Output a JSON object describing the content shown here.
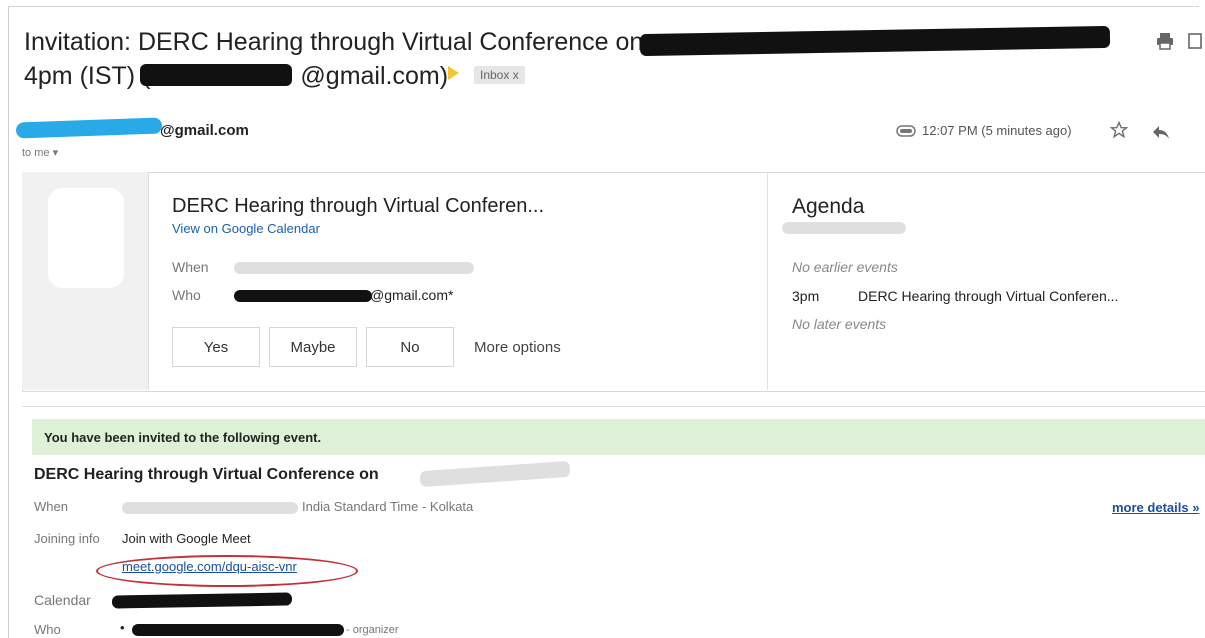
{
  "email": {
    "subject_line1": "Invitation: DERC Hearing through Virtual Conference on",
    "subject_line2_start": "4pm (IST) (",
    "subject_line2_end": "@gmail.com)",
    "inbox_badge": "Inbox x",
    "sender_suffix": "@gmail.com",
    "to_me": "to me ▾",
    "time": "12:07 PM (5 minutes ago)",
    "icons": [
      "printer-icon",
      "new-window-icon",
      "label-icon",
      "star-icon",
      "reply-icon"
    ]
  },
  "invite_card": {
    "title": "DERC Hearing through Virtual Conferen...",
    "view_link": "View on Google Calendar",
    "when_label": "When",
    "who_label": "Who",
    "who_value_suffix": "@gmail.com*",
    "rsvp": [
      "Yes",
      "Maybe",
      "No"
    ],
    "more_options": "More options"
  },
  "agenda": {
    "title": "Agenda",
    "no_earlier": "No earlier events",
    "event_time": "3pm",
    "event_title": "DERC Hearing through Virtual Conferen...",
    "no_later": "No later events"
  },
  "event_body": {
    "invited_text": "You have been invited to the following event.",
    "title": "DERC Hearing through Virtual Conference on",
    "when_label": "When",
    "when_value": "India Standard Time - Kolkata",
    "more_details": "more details »",
    "joining_label": "Joining info",
    "joining_value": "Join with Google Meet",
    "meet_link": "meet.google.com/dqu-aisc-vnr",
    "calendar_label": "Calendar",
    "who_label": "Who",
    "organizer": "- organizer"
  },
  "colors": {
    "green_banner": "#dff0d8",
    "link": "#1a5fb4",
    "highlight_oval": "#c2303a",
    "important_marker": "#f2c531"
  }
}
